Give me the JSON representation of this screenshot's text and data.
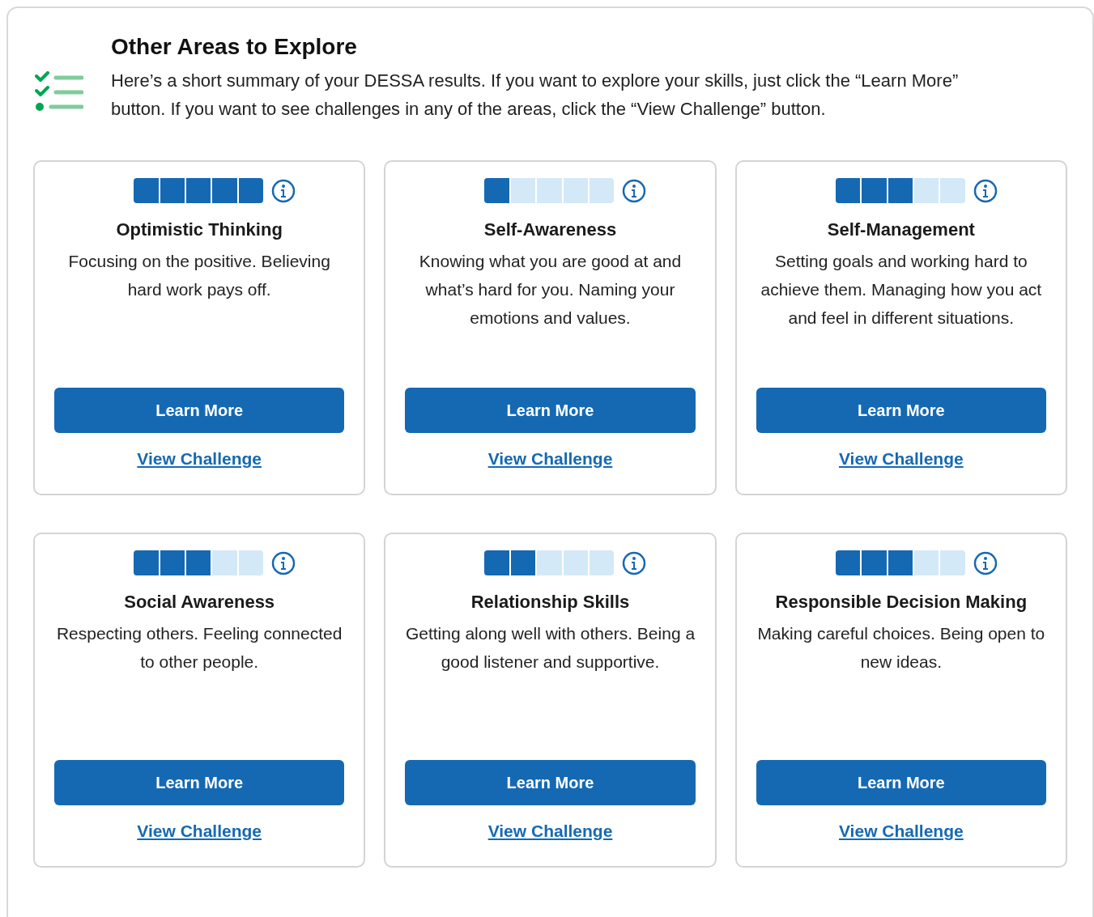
{
  "header": {
    "title": "Other Areas to Explore",
    "summary": "Here’s a short summary of your DESSA results. If you want to explore your skills, just click the “Learn More” button. If you want to see challenges in any of the areas, click the “View Challenge” button."
  },
  "areas": [
    {
      "title": "Optimistic Thinking",
      "level": 1,
      "description": "Focusing on the positive. Believing hard work pays off.",
      "button": "Learn More",
      "link": "View Challenge"
    },
    {
      "title": "Self-Awareness",
      "level": 0.2,
      "description": "Knowing what you are good at and what’s hard for you. Naming your emotions and values.",
      "button": "Learn More",
      "link": "View Challenge"
    },
    {
      "title": "Self-Management",
      "level": 0.6,
      "description": "Setting goals and working hard to achieve them. Managing how you act and feel in different situations.",
      "button": "Learn More",
      "link": "View Challenge"
    },
    {
      "title": "Social Awareness",
      "level": 0.6,
      "description": "Respecting others. Feeling connected to other people.",
      "button": "Learn More",
      "link": "View Challenge"
    },
    {
      "title": "Relationship Skills",
      "level": 0.4,
      "description": "Getting along well with others. Being a good listener and supportive.",
      "button": "Learn More",
      "link": "View Challenge"
    },
    {
      "title": "Responsible Decision Making",
      "level": 0.6,
      "description": "Making careful choices. Being open to new ideas.",
      "button": "Learn More",
      "link": "View Challenge"
    }
  ]
}
